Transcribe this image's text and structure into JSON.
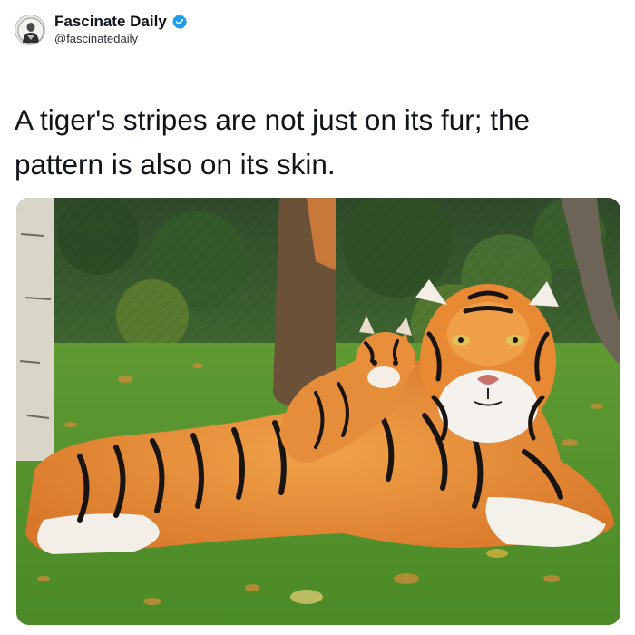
{
  "author": {
    "display_name": "Fascinate Daily",
    "handle": "@fascinatedaily",
    "verified": true,
    "avatar_icon": "portrait-avatar"
  },
  "tweet": {
    "text": "A tiger's stripes are not just on its fur; the pattern is also on its skin."
  },
  "colors": {
    "verified_badge": "#1d9bf0",
    "text": "#0f1419"
  },
  "media": {
    "subject": "adult tiger lying on grass with cub resting on its back"
  }
}
